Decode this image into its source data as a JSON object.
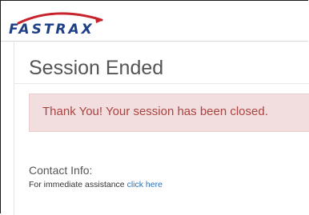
{
  "brand": {
    "logo_text": "FASTRAX",
    "colors": {
      "navy": "#1d3f86",
      "red": "#c8232c"
    }
  },
  "page": {
    "title": "Session Ended"
  },
  "alert": {
    "message": "Thank You! Your session has been closed."
  },
  "contact": {
    "label": "Contact Info:",
    "assist_text": "For immediate assistance",
    "link_text": "click here"
  }
}
